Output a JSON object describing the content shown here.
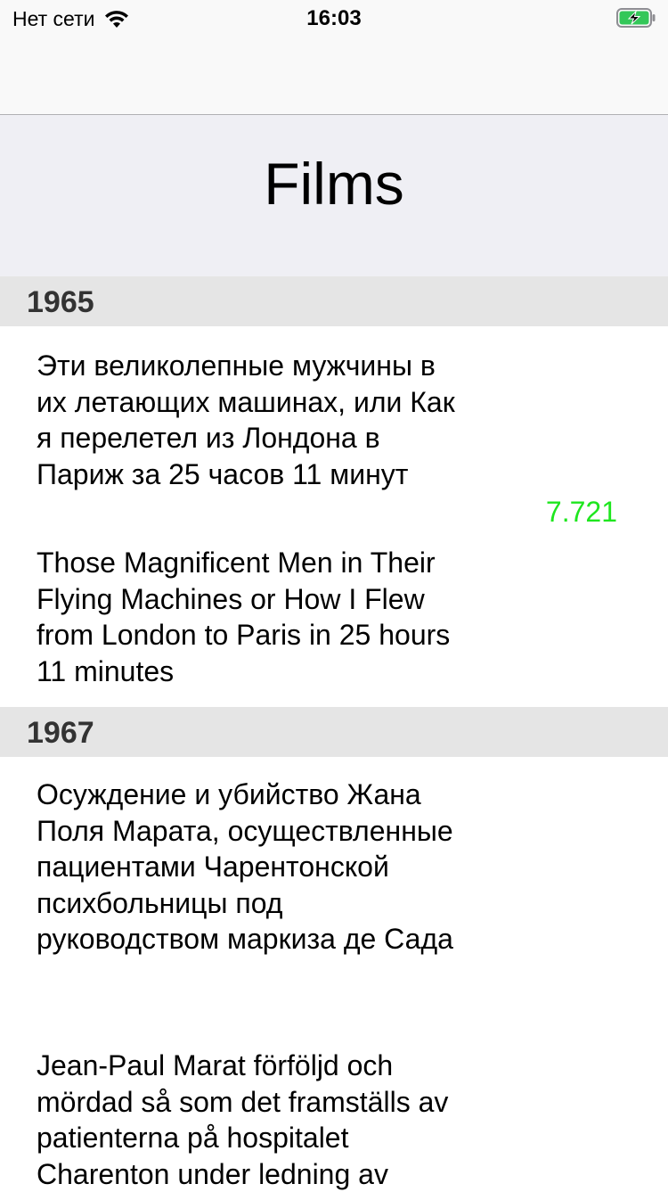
{
  "status_bar": {
    "carrier": "Нет сети",
    "time": "16:03",
    "wifi_icon": "wifi-icon",
    "battery_icon": "battery-charging-icon",
    "battery_color": "#34c759"
  },
  "header": {
    "title": "Films"
  },
  "sections": [
    {
      "year": "1965",
      "films": [
        {
          "local_title": "Эти великолепные мужчины в их летающих машинах, или Как я перелетел из Лондона в Париж за 25 часов 11 минут",
          "original_title": "Those Magnificent Men in Their Flying Machines or How I Flew from London to Paris in 25 hours 11 minutes",
          "rating": "7.721"
        }
      ]
    },
    {
      "year": "1967",
      "films": [
        {
          "local_title": "Осуждение и убийство Жана Поля Марата, осуществленные пациентами Чарентонской психбольницы под руководством маркиза де Сада",
          "original_title": "Jean-Paul Marat förföljd och mördad så som det framställs av patienterna på hospitalet Charenton under ledning av",
          "rating": ""
        }
      ]
    }
  ],
  "colors": {
    "rating": "#1ee61e",
    "section_header_bg": "#e5e5e5",
    "title_area_bg": "#efeff4"
  }
}
